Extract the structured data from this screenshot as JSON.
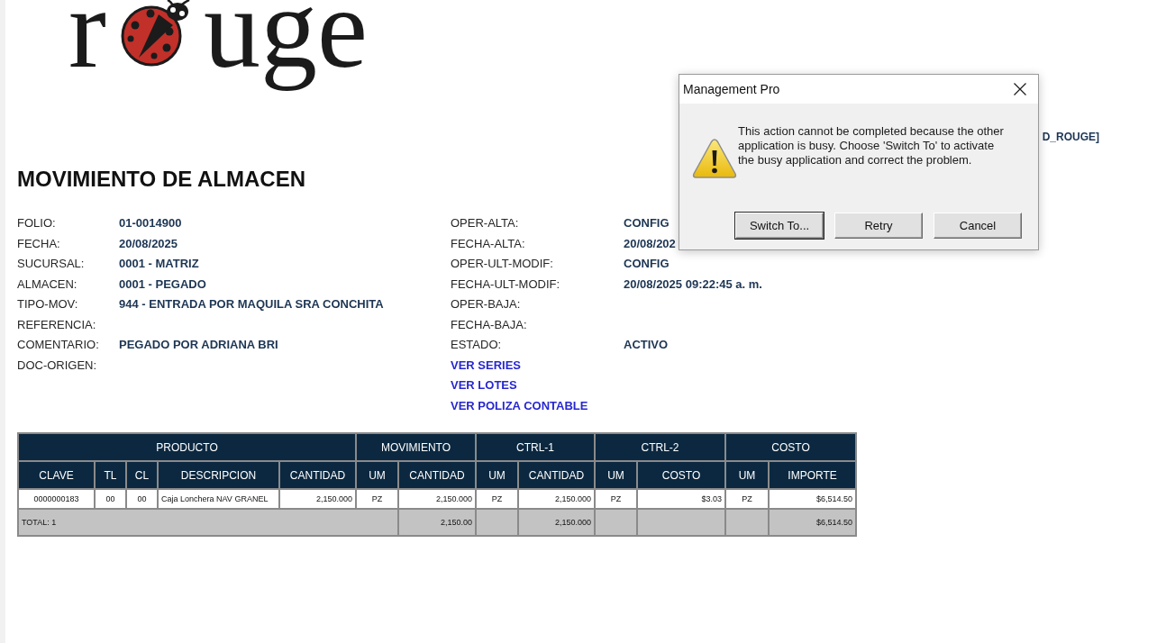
{
  "logo": {
    "prefix": "r",
    "suffix": "uge"
  },
  "print_info": "D_ROUGE]",
  "title": "MOVIMIENTO DE ALMACEN",
  "fields_left": [
    {
      "label": "FOLIO:",
      "value": "01-0014900"
    },
    {
      "label": "FECHA:",
      "value": "20/08/2025"
    },
    {
      "label": "SUCURSAL:",
      "value": "0001 - MATRIZ"
    },
    {
      "label": "ALMACEN:",
      "value": "0001 - PEGADO"
    },
    {
      "label": "TIPO-MOV:",
      "value": "944 - ENTRADA POR MAQUILA SRA CONCHITA"
    },
    {
      "label": "REFERENCIA:"
    },
    {
      "label": "COMENTARIO:",
      "value": "PEGADO POR ADRIANA BRI"
    },
    {
      "label": "DOC-ORIGEN:"
    }
  ],
  "fields_right": [
    {
      "label": "OPER-ALTA:",
      "value": "CONFIG"
    },
    {
      "label": "FECHA-ALTA:",
      "value": "20/08/202"
    },
    {
      "label": "OPER-ULT-MODIF:",
      "value": "CONFIG"
    },
    {
      "label": "FECHA-ULT-MODIF:",
      "value": "20/08/2025 09:22:45 a. m."
    },
    {
      "label": "OPER-BAJA:"
    },
    {
      "label": "FECHA-BAJA:"
    },
    {
      "label": "ESTADO:",
      "value": "ACTIVO"
    }
  ],
  "links": [
    "VER SERIES",
    "VER LOTES",
    "VER POLIZA CONTABLE"
  ],
  "table": {
    "groups": [
      {
        "label": "PRODUCTO",
        "columns": [
          {
            "label": "CLAVE",
            "kind": "code"
          },
          {
            "label": "TL",
            "kind": "code"
          },
          {
            "label": "CL",
            "kind": "code"
          },
          {
            "label": "DESCRIPCION",
            "kind": "text"
          },
          {
            "label": "CANTIDAD",
            "kind": "number"
          }
        ]
      },
      {
        "label": "MOVIMIENTO",
        "columns": [
          {
            "label": "UM",
            "kind": "unit"
          },
          {
            "label": "CANTIDAD",
            "kind": "number"
          }
        ]
      },
      {
        "label": "CTRL-1",
        "columns": [
          {
            "label": "UM",
            "kind": "unit"
          },
          {
            "label": "CANTIDAD",
            "kind": "number"
          }
        ]
      },
      {
        "label": "CTRL-2",
        "columns": [
          {
            "label": "UM",
            "kind": "unit"
          },
          {
            "label": "COSTO",
            "kind": "number"
          }
        ]
      },
      {
        "label": "COSTO",
        "columns": [
          {
            "label": "UM",
            "kind": "unit"
          },
          {
            "label": "IMPORTE",
            "kind": "number"
          }
        ]
      }
    ],
    "rows": [
      [
        "0000000183",
        "00",
        "00",
        "Caja Lonchera NAV GRANEL",
        "2,150.000",
        "PZ",
        "2,150.000",
        "PZ",
        "2,150.000",
        "PZ",
        "$3.03",
        "PZ",
        "$6,514.50"
      ]
    ],
    "total": [
      {
        "kind": "label",
        "text": "TOTAL: 1"
      },
      {
        "kind": "number",
        "text": "2,150.00"
      },
      {
        "kind": "blank"
      },
      {
        "kind": "number",
        "text": "2,150.000"
      },
      {
        "kind": "blank"
      },
      {
        "kind": "blank"
      },
      {
        "kind": "blank"
      },
      {
        "kind": "number",
        "text": "$6,514.50"
      }
    ]
  },
  "dialog": {
    "title": "Management Pro",
    "message": "This action cannot be completed because the other application is busy. Choose 'Switch To' to activate the busy application and correct the problem.",
    "buttons": [
      {
        "label": "Switch To...",
        "default": true
      },
      {
        "label": "Retry",
        "default": false
      },
      {
        "label": "Cancel",
        "default": false
      }
    ]
  }
}
